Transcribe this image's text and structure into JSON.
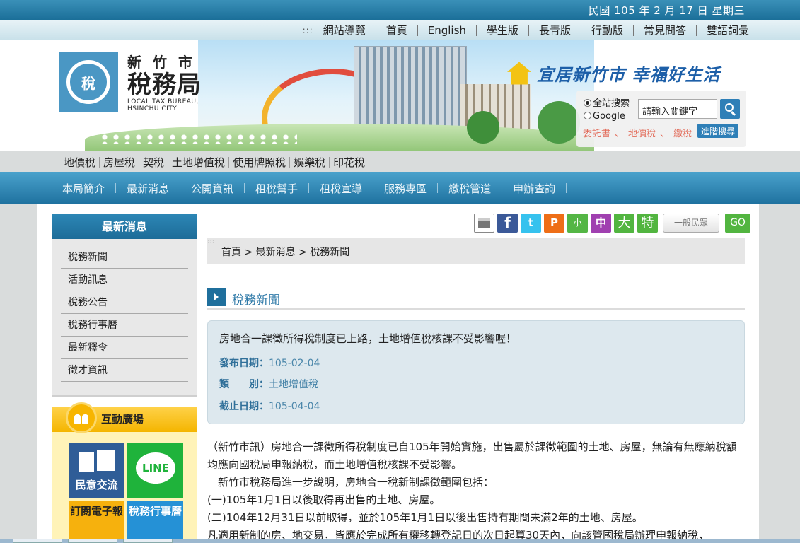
{
  "date": "民國 105 年 2 月 17 日 星期三",
  "topnav": {
    "dots": ":::",
    "items": [
      "網站導覽",
      "首頁",
      "English",
      "學生版",
      "長青版",
      "行動版",
      "常見問答",
      "雙語詞彙"
    ]
  },
  "logo": {
    "icon_char": "稅",
    "city": "新竹市",
    "bureau": "稅務局",
    "en_line1": "LOCAL TAX BUREAU,",
    "en_line2": "HSINCHU CITY"
  },
  "slogan": "宜居新竹市 幸福好生活",
  "search": {
    "option_site": "全站搜索",
    "option_google": "Google",
    "placeholder": "請輸入關鍵字",
    "links": [
      "委託書",
      "地價稅",
      "繳稅"
    ],
    "link_sep": "、",
    "advanced": "進階搜尋"
  },
  "taxbar": [
    "地價稅",
    "房屋稅",
    "契稅",
    "土地增值稅",
    "使用牌照稅",
    "娛樂稅",
    "印花稅"
  ],
  "mainnav": [
    "本局簡介",
    "最新消息",
    "公開資訊",
    "租稅幫手",
    "租稅宣導",
    "服務專區",
    "繳稅管道",
    "申辦查詢"
  ],
  "sidebar": {
    "title": "最新消息",
    "items": [
      "稅務新聞",
      "活動訊息",
      "稅務公告",
      "稅務行事曆",
      "最新釋令",
      "徵才資訊"
    ]
  },
  "interact": {
    "title": "互動廣場",
    "tiles": [
      "民意交流",
      "LINE",
      "訂閱電子報",
      "稅務行事曆"
    ]
  },
  "share": {
    "fb": "f",
    "tw": "t",
    "plurk": "P",
    "small": "小",
    "mid": "中",
    "big": "大",
    "special": "特",
    "mode": "一般民眾",
    "go": "GO"
  },
  "breadcrumb": {
    "dots": ":::",
    "text": "首頁 > 最新消息 > 稅務新聞"
  },
  "section_title": "稅務新聞",
  "news": {
    "title": "房地合一課徵所得稅制度已上路，土地增值稅核課不受影響喔！",
    "publish_label": "發布日期：",
    "publish_value": "105-02-04",
    "category_label": "類　　別：",
    "category_value": "土地增值稅",
    "deadline_label": "截止日期：",
    "deadline_value": "105-04-04"
  },
  "article": {
    "p1": "（新竹市訊）房地合一課徵所得稅制度已自105年開始實施，出售屬於課徵範圍的土地、房屋，無論有無應納稅額均應向國稅局申報納稅，而土地增值稅核課不受影響。",
    "p2": "　新竹市稅務局進一步說明，房地合一稅新制課徵範圍包括：",
    "p3": "(一)105年1月1日以後取得再出售的土地、房屋。",
    "p4": "(二)104年12月31日以前取得，並於105年1月1日以後出售持有期間未滿2年的土地、房屋。",
    "p5": "凡適用新制的房、地交易，皆應於完成所有權移轉登記日的次日起算30天內，向該管國稅局辦理申報納稅，"
  }
}
